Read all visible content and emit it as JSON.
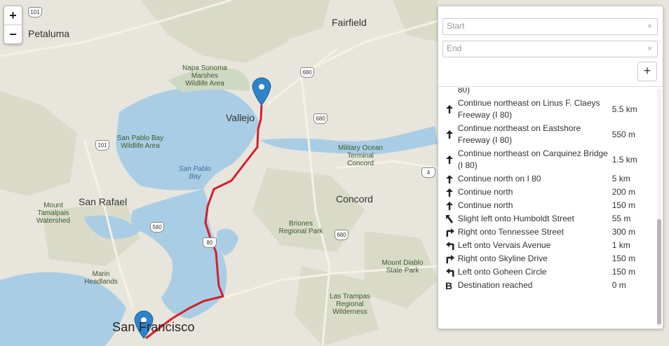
{
  "map": {
    "colors": {
      "water": "#a9cde5",
      "land": "#e8e5dc",
      "hills": "#d7d9c4",
      "route": "#d4202c",
      "marker": "#2e83cb"
    },
    "labels": {
      "petaluma": "Petaluma",
      "fairfield": "Fairfield",
      "napa_marshes": "Napa Sonoma Marshes Wildlife Area",
      "vallejo": "Vallejo",
      "san_pablo_refuge": "San Pablo Bay Wildlife Area",
      "san_pablo_bay": "San Pablo Bay",
      "military_terminal": "Military Ocean Terminal Concord",
      "san_rafael": "San Rafael",
      "mount_tamalpais": "Mount Tamalpais Watershed",
      "concord": "Concord",
      "briones": "Briones Regional Park",
      "marin_headlands": "Marin Headlands",
      "mount_diablo": "Mount Diablo State Park",
      "las_trampas": "Las Trampas Regional Wilderness",
      "san_francisco": "San Francisco"
    },
    "shields": {
      "s101a": "101",
      "s101b": "101",
      "s680a": "680",
      "s680b": "680",
      "s680c": "680",
      "s580": "580",
      "s80": "80",
      "s4": "4"
    }
  },
  "zoom": {
    "in_label": "+",
    "out_label": "−"
  },
  "router": {
    "start_placeholder": "Start",
    "end_placeholder": "End",
    "clear_glyph": "×",
    "add_label": "+",
    "steps": [
      {
        "icon": "straight",
        "text": "80)",
        "distance": ""
      },
      {
        "icon": "straight",
        "text": "Continue northeast on Linus F. Claeys Freeway (I 80)",
        "distance": "5.5 km"
      },
      {
        "icon": "straight",
        "text": "Continue northeast on Eastshore Freeway (I 80)",
        "distance": "550 m"
      },
      {
        "icon": "straight",
        "text": "Continue northeast on Carquinez Bridge (I 80)",
        "distance": "1.5 km"
      },
      {
        "icon": "straight",
        "text": "Continue north on I 80",
        "distance": "5 km"
      },
      {
        "icon": "straight",
        "text": "Continue north",
        "distance": "200 m"
      },
      {
        "icon": "straight",
        "text": "Continue north",
        "distance": "150 m"
      },
      {
        "icon": "slight-left",
        "text": "Slight left onto Humboldt Street",
        "distance": "55 m"
      },
      {
        "icon": "right",
        "text": "Right onto Tennessee Street",
        "distance": "300 m"
      },
      {
        "icon": "left",
        "text": "Left onto Vervais Avenue",
        "distance": "1 km"
      },
      {
        "icon": "right",
        "text": "Right onto Skyline Drive",
        "distance": "150 m"
      },
      {
        "icon": "left",
        "text": "Left onto Goheen Circle",
        "distance": "150 m"
      },
      {
        "icon": "destination",
        "text": "Destination reached",
        "distance": "0 m"
      }
    ]
  }
}
